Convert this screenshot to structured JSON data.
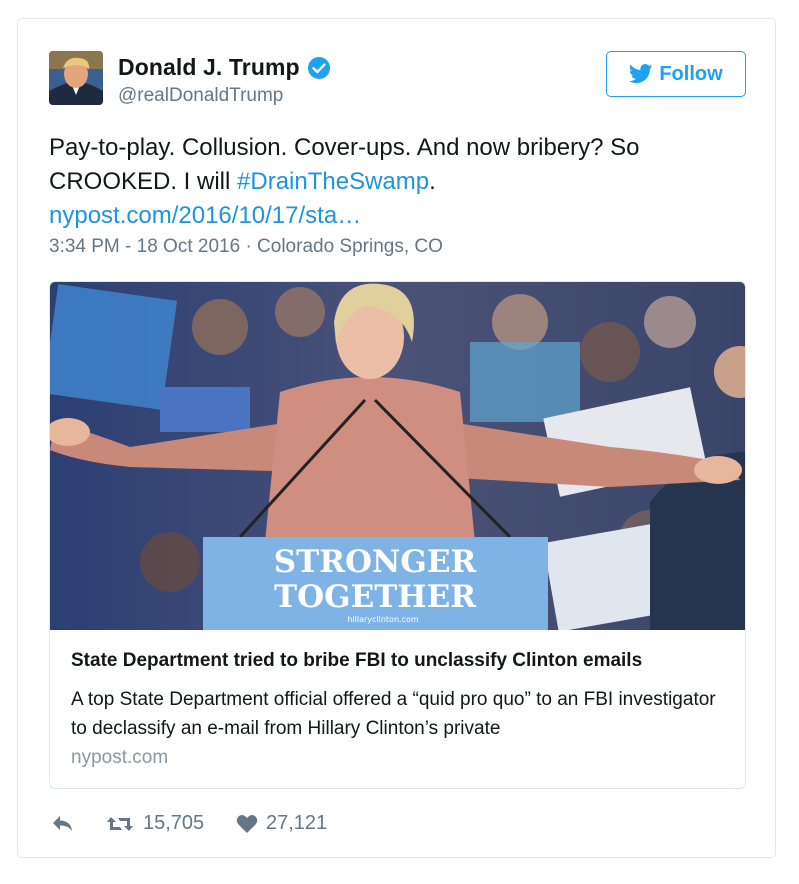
{
  "author": {
    "name": "Donald J. Trump",
    "handle": "@realDonaldTrump"
  },
  "follow_button": {
    "label": "Follow"
  },
  "tweet": {
    "text_before_hashtag": "Pay-to-play. Collusion. Cover-ups. And now bribery? So CROOKED. I will ",
    "hashtag": "#DrainTheSwamp",
    "text_after_hashtag": ".",
    "link": "nypost.com/2016/10/17/sta…",
    "timestamp": "3:34 PM - 18 Oct 2016 · Colorado Springs, CO"
  },
  "link_card": {
    "podium_line1": "STRONGER",
    "podium_line2": "TOGETHER",
    "podium_site": "hillaryclinton.com",
    "title": "State Department tried to bribe FBI to unclassify Clinton emails",
    "description": "A top State Department official offered a “quid pro quo” to an FBI investigator to declassify an e-mail from Hillary Clinton’s private",
    "domain": "nypost.com"
  },
  "actions": {
    "retweets": "15,705",
    "likes": "27,121"
  },
  "colors": {
    "link": "#1b95e0",
    "verified": "#1da1f2",
    "muted": "#657786"
  },
  "icons": [
    "verified-badge-icon",
    "twitter-bird-icon",
    "reply-icon",
    "retweet-icon",
    "heart-icon"
  ]
}
